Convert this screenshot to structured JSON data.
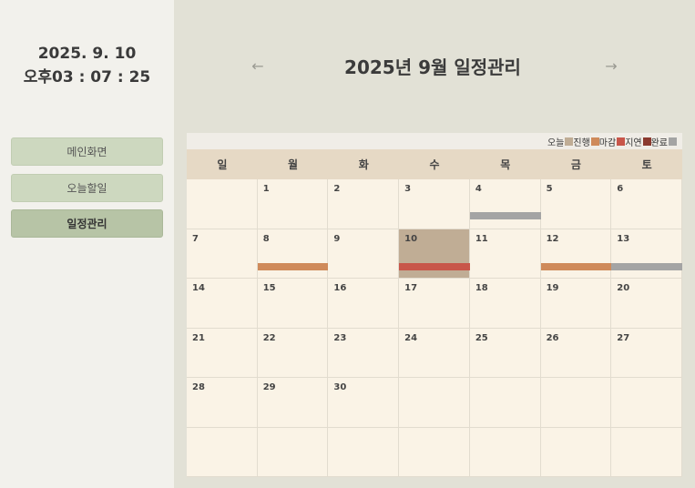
{
  "clock": {
    "date": "2025. 9. 10",
    "time": "오후03 : 07 : 25"
  },
  "menu": [
    {
      "label": "메인화면",
      "active": false
    },
    {
      "label": "오늘할일",
      "active": false
    },
    {
      "label": "일정관리",
      "active": true
    }
  ],
  "header": {
    "title": "2025년 9월 일정관리",
    "prev_icon": "←",
    "next_icon": "→"
  },
  "legend": [
    {
      "label": "오늘",
      "color": "#c0ad95"
    },
    {
      "label": "진행",
      "color": "#cf8a5a"
    },
    {
      "label": "마감",
      "color": "#c8564a"
    },
    {
      "label": "지연",
      "color": "#8b3a2f"
    },
    {
      "label": "완료",
      "color": "#a4a4a4"
    }
  ],
  "weekdays": [
    "일",
    "월",
    "화",
    "수",
    "목",
    "금",
    "토"
  ],
  "calendar": {
    "first_weekday": 1,
    "days_in_month": 30,
    "today": 10,
    "events": [
      {
        "day": 4,
        "status": "완료",
        "color": "#a4a4a4",
        "bar_level": "upper"
      },
      {
        "day": 8,
        "status": "진행",
        "color": "#cf8a5a",
        "bar_level": "lower"
      },
      {
        "day": 10,
        "status": "마감",
        "color": "#c8564a",
        "bar_level": "lower"
      },
      {
        "day": 12,
        "status": "진행",
        "color": "#cf8a5a",
        "bar_level": "lower"
      },
      {
        "day": 13,
        "status": "완료",
        "color": "#a4a4a4",
        "bar_level": "lower"
      }
    ]
  }
}
